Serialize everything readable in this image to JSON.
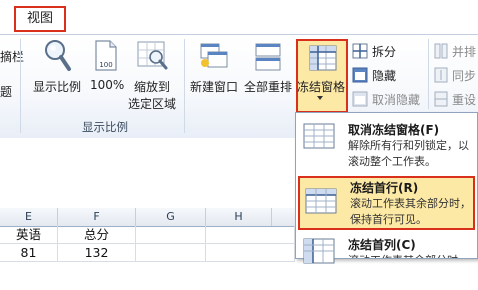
{
  "tabs": {
    "view": "视图"
  },
  "ribbon": {
    "left_partial_top": "摘栏",
    "left_partial_bottom": "题",
    "zoom_group": {
      "zoom_label": "显示比例",
      "hundred_label": "100%",
      "fit_selection_label_1": "缩放到",
      "fit_selection_label_2": "选定区域",
      "group_label": "显示比例"
    },
    "window_group": {
      "new_window_label": "新建窗口",
      "arrange_all_label": "全部重排",
      "freeze_panes_label": "冻结窗格",
      "split_label": "拆分",
      "hide_label": "隐藏",
      "unhide_label": "取消隐藏",
      "side_by_side_label": "并排",
      "sync_scroll_label": "同步",
      "reset_position_label": "重设"
    }
  },
  "sheet": {
    "columns": [
      "E",
      "F",
      "G",
      "H"
    ],
    "rows": [
      [
        "英语",
        "总分"
      ],
      [
        "81",
        "132"
      ]
    ]
  },
  "freeze_menu": {
    "items": [
      {
        "title": "取消冻结窗格(F)",
        "desc": "解除所有行和列锁定，以滚动整个工作表。"
      },
      {
        "title": "冻结首行(R)",
        "desc": "滚动工作表其余部分时，保持首行可见。"
      },
      {
        "title": "冻结首列(C)",
        "desc": "滚动工作表其余部分时，保持首列可见。"
      }
    ]
  },
  "colors": {
    "highlight_border": "#d9301c",
    "hover_fill": "#fde9a6",
    "ribbon_border": "#b8c6d9"
  }
}
